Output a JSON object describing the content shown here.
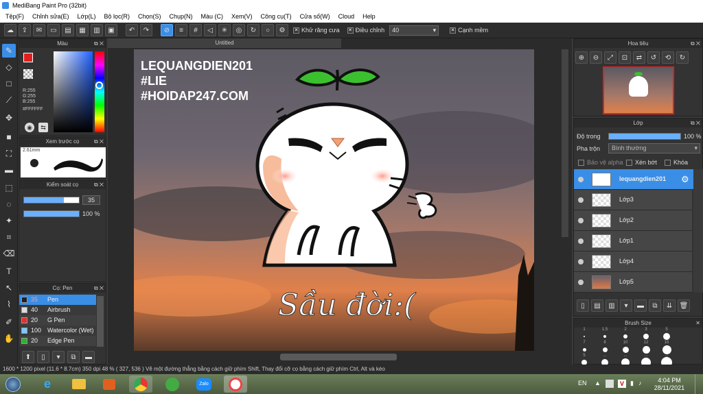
{
  "window": {
    "title": "MediBang Paint Pro (32bit)"
  },
  "menu": [
    "Tệp(F)",
    "Chỉnh sửa(E)",
    "Lớp(L)",
    "Bộ lọc(R)",
    "Chọn(S)",
    "Chụp(N)",
    "Màu (C)",
    "Xem(V)",
    "Công cụ(T)",
    "Cửa số(W)",
    "Cloud",
    "Help"
  ],
  "toolbar": {
    "antialias_label": "Khử răng cưa",
    "adjust_label": "Điều chỉnh",
    "adjust_value": "40",
    "sharp_label": "Cạnh mềm"
  },
  "color_panel": {
    "title": "Màu",
    "r": "R:255",
    "g": "G:255",
    "b": "B:255",
    "hex": "#FFFFFF"
  },
  "preview_panel": {
    "title": "Xem trước cọ",
    "size": "2.61mm"
  },
  "brush_control": {
    "title": "Kiểm soát cọ",
    "size_value": "35",
    "opacity_value": "100 %",
    "size_fraction": 0.72,
    "opacity_fraction": 1.0
  },
  "brush_panel": {
    "title": "Cọ: Pen",
    "items": [
      {
        "size": "35",
        "name": "Pen",
        "color": "#222222",
        "selected": true
      },
      {
        "size": "40",
        "name": "Airbrush",
        "color": "#dddddd",
        "selected": false
      },
      {
        "size": "20",
        "name": "G Pen",
        "color": "#e03030",
        "selected": false
      },
      {
        "size": "100",
        "name": "Watercolor (Wet)",
        "color": "#7ec8ff",
        "selected": false
      },
      {
        "size": "20",
        "name": "Edge Pen",
        "color": "#30b030",
        "selected": false
      }
    ]
  },
  "document": {
    "title": "Untitled"
  },
  "artwork": {
    "watermark_line1": "LEQUANGDIEN201",
    "watermark_line2": "#LIE",
    "watermark_line3": "#HOIDAP247.COM",
    "caption": "Sầu đời:("
  },
  "navigator": {
    "title": "Hoa tiêu"
  },
  "layer_panel": {
    "title": "Lớp",
    "opacity_label": "Độ trong",
    "opacity_value": "100 %",
    "blend_label": "Pha trộn",
    "blend_value": "Bình thường",
    "protect_alpha": "Bảo vệ alpha",
    "clip_label": "Xén bớt",
    "lock_label": "Khóa",
    "layers": [
      {
        "name": "lequangdien201",
        "selected": true
      },
      {
        "name": "Lớp3",
        "selected": false
      },
      {
        "name": "Lớp2",
        "selected": false
      },
      {
        "name": "Lớp1",
        "selected": false
      },
      {
        "name": "Lớp4",
        "selected": false
      },
      {
        "name": "Lớp5",
        "selected": false
      }
    ]
  },
  "brush_size_panel": {
    "title": "Brush Size",
    "row1": [
      "1",
      "1.5",
      "2",
      "3",
      "5"
    ],
    "row2": [
      "7",
      "8",
      "10",
      "12",
      "15"
    ],
    "row3": [
      "5",
      "...",
      "...",
      "...",
      "..."
    ]
  },
  "status": {
    "text": "1600 * 1200 pixel  (11.6 * 8.7cm)  350 dpi  48 %  ( 327, 536 )  Vẽ một đường thẳng bằng cách giữ phím Shift, Thay đổi cỡ cọ bằng cách giữ phím Ctrl, Alt và kéo"
  },
  "taskbar": {
    "lang": "EN",
    "time": "4:04 PM",
    "date": "28/11/2021"
  },
  "colors": {
    "accent": "#3a8ee6",
    "panel": "#333333",
    "sprout": "#3bbf2f"
  }
}
